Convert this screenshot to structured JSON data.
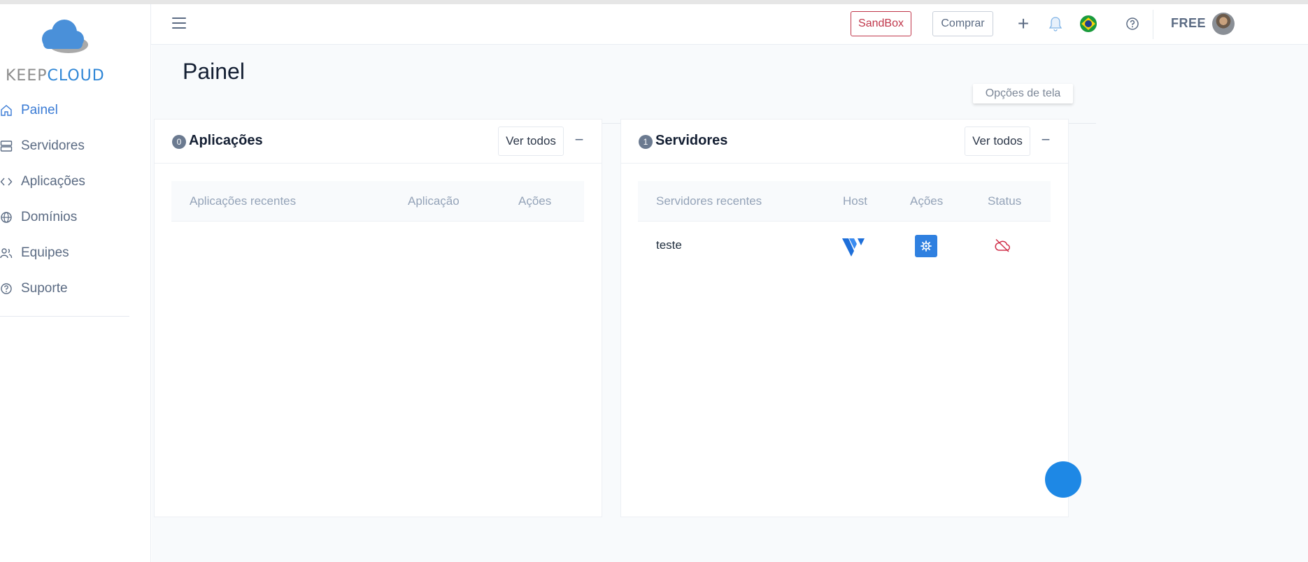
{
  "app": {
    "logo_text_part1": "KEEP",
    "logo_text_part2": "CLOUD"
  },
  "sidebar": {
    "items": [
      {
        "label": "Painel",
        "icon": "home-icon",
        "active": true
      },
      {
        "label": "Servidores",
        "icon": "server-icon",
        "active": false
      },
      {
        "label": "Aplicações",
        "icon": "code-icon",
        "active": false
      },
      {
        "label": "Domínios",
        "icon": "globe-icon",
        "active": false
      },
      {
        "label": "Equipes",
        "icon": "users-icon",
        "active": false
      },
      {
        "label": "Suporte",
        "icon": "help-circle-icon",
        "active": false
      }
    ]
  },
  "header": {
    "sandbox_label": "SandBox",
    "comprar_label": "Comprar",
    "plus_glyph": "+",
    "plan_label": "FREE",
    "menu_icon": "hamburger-icon",
    "notification_icon": "bell-icon",
    "language_icon": "brazil-flag-icon",
    "help_icon": "help-icon"
  },
  "main": {
    "title": "Painel",
    "screen_options_label": "Opções de tela"
  },
  "cards": {
    "apps": {
      "count": "0",
      "title": "Aplicações",
      "view_all_label": "Ver todos",
      "collapse_glyph": "−",
      "columns": [
        "Aplicações recentes",
        "Aplicação",
        "Ações"
      ],
      "rows": []
    },
    "servers": {
      "count": "1",
      "title": "Servidores",
      "view_all_label": "Ver todos",
      "collapse_glyph": "−",
      "columns": [
        "Servidores recentes",
        "Host",
        "Ações",
        "Status"
      ],
      "rows": [
        {
          "name": "teste",
          "host_icon": "vultr-logo-icon",
          "action_icon": "gear-icon",
          "status_icon": "cloud-off-icon"
        }
      ]
    }
  },
  "colors": {
    "accent": "#3a7bd5",
    "sandbox": "#c0364a",
    "gear_button": "#2f80e0",
    "status_offline": "#d0304a"
  }
}
